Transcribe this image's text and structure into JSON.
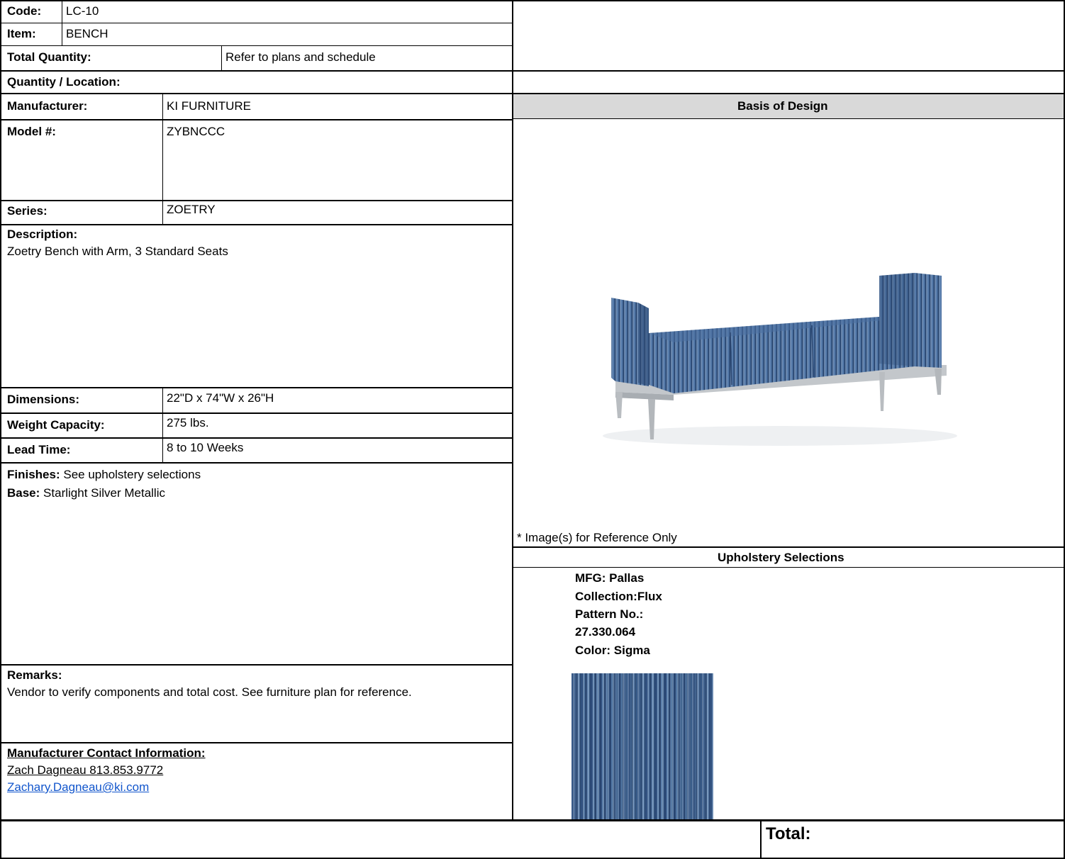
{
  "header": {
    "code_label": "Code:",
    "code_value": "LC-10",
    "item_label": "Item:",
    "item_value": "BENCH",
    "total_qty_label": "Total Quantity:",
    "total_qty_value": "Refer to plans and schedule",
    "qty_location_label": "Quantity / Location:"
  },
  "specs": {
    "manufacturer_label": "Manufacturer:",
    "manufacturer_value": "KI FURNITURE",
    "model_label": "Model #:",
    "model_value": "ZYBNCCC",
    "series_label": "Series:",
    "series_value": "ZOETRY",
    "description_label": "Description:",
    "description_value": "Zoetry Bench with Arm, 3 Standard Seats",
    "dimensions_label": "Dimensions:",
    "dimensions_value": "22\"D x 74\"W x 26\"H",
    "weight_label": "Weight Capacity:",
    "weight_value": "275 lbs.",
    "lead_label": "Lead Time:",
    "lead_value": "8 to 10 Weeks",
    "finishes_label": "Finishes:",
    "finishes_value": "See upholstery selections",
    "base_label": "Base:",
    "base_value": "Starlight Silver Metallic",
    "remarks_label": "Remarks:",
    "remarks_value": "Vendor to verify components and total cost. See furniture plan for reference."
  },
  "contact": {
    "heading": "Manufacturer Contact Information:",
    "name_phone": "Zach Dagneau 813.853.9772",
    "email": "Zachary.Dagneau@ki.com"
  },
  "design": {
    "basis_title": "Basis of Design",
    "image_note": "* Image(s) for Reference Only",
    "image_icon": "bench-image",
    "upholstery_title": "Upholstery Selections",
    "upholstery_lines": [
      "MFG: Pallas",
      "Collection:Flux",
      "Pattern No.:",
      "27.330.064",
      "Color: Sigma"
    ]
  },
  "footer": {
    "total_label": "Total:"
  },
  "colors": {
    "header_gray": "#d9d9d9",
    "link_blue": "#1155cc",
    "fabric_blue": "#3b5f8f",
    "base_silver": "#bfc3c7"
  }
}
